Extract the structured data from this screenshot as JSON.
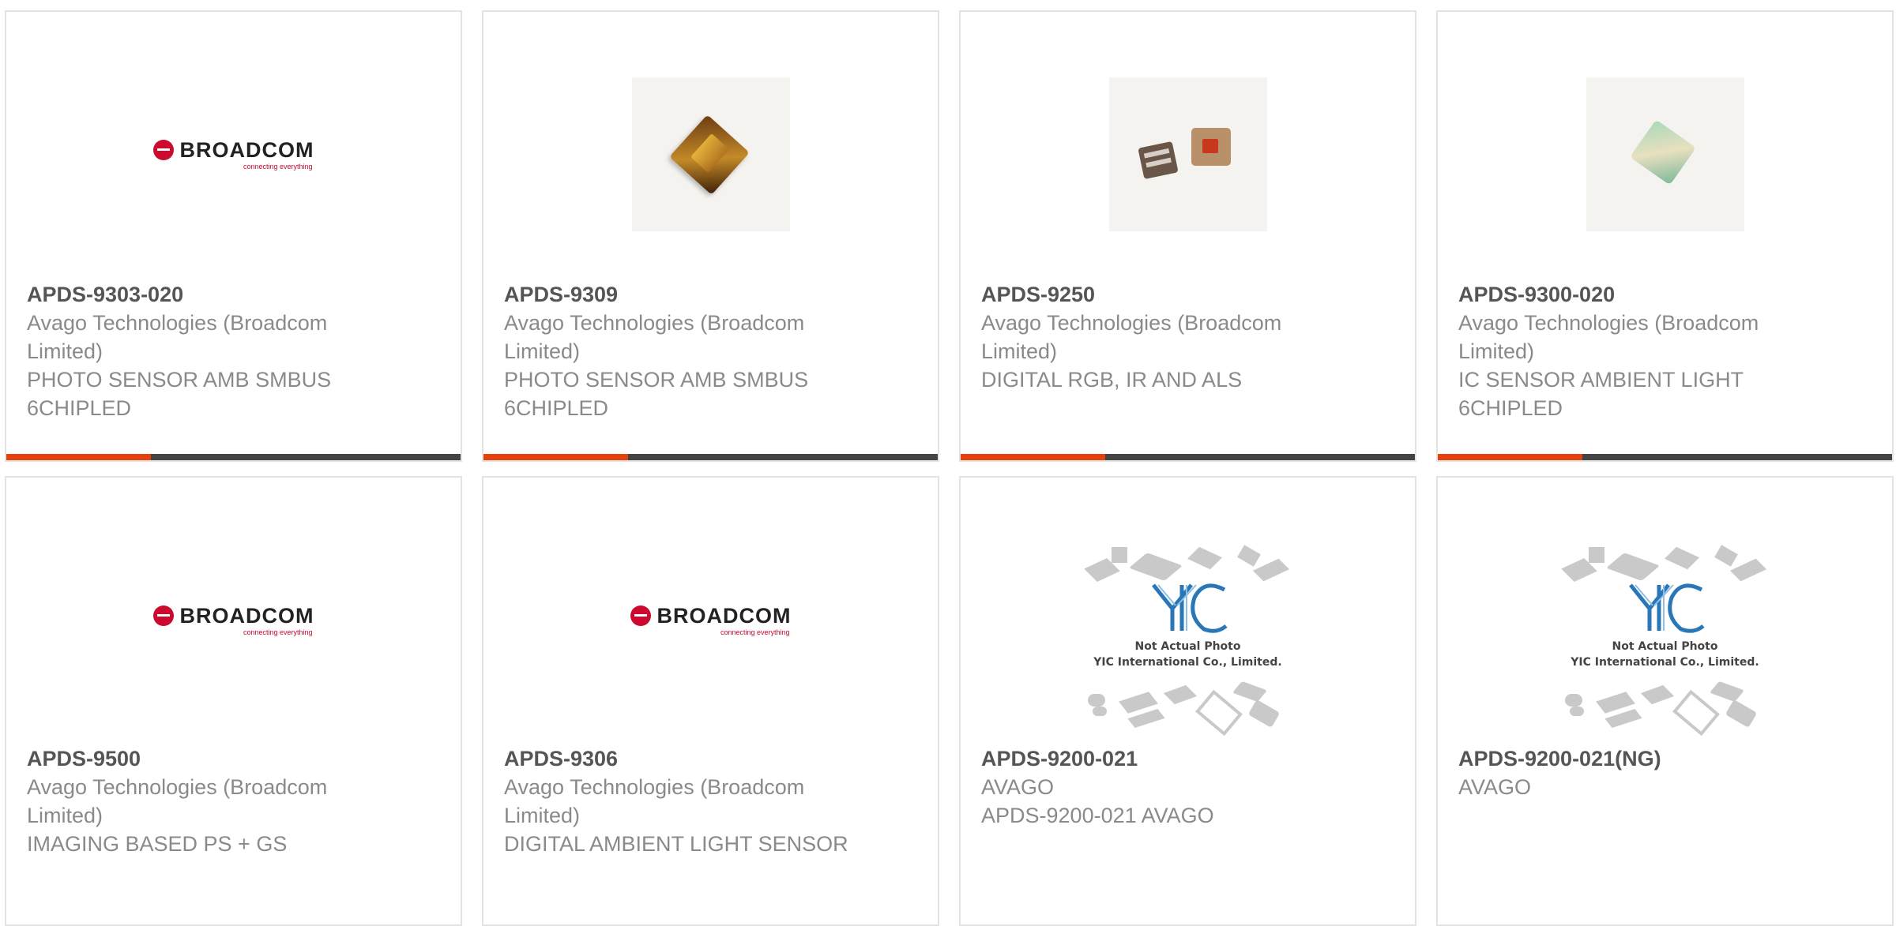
{
  "products": [
    {
      "part_number": "APDS-9303-020",
      "manufacturer": "Avago Technologies (Broadcom Limited)",
      "description": "PHOTO SENSOR AMB SMBUS 6CHIPLED",
      "image": "broadcom-logo"
    },
    {
      "part_number": "APDS-9309",
      "manufacturer": "Avago Technologies (Broadcom Limited)",
      "description": "PHOTO SENSOR AMB SMBUS 6CHIPLED",
      "image": "chip-photo"
    },
    {
      "part_number": "APDS-9250",
      "manufacturer": "Avago Technologies (Broadcom Limited)",
      "description": "DIGITAL RGB, IR AND ALS",
      "image": "chip-photo"
    },
    {
      "part_number": "APDS-9300-020",
      "manufacturer": "Avago Technologies (Broadcom Limited)",
      "description": "IC SENSOR AMBIENT LIGHT 6CHIPLED",
      "image": "chip-photo"
    },
    {
      "part_number": "APDS-9500",
      "manufacturer": "Avago Technologies (Broadcom Limited)",
      "description": "IMAGING BASED PS + GS",
      "image": "broadcom-logo"
    },
    {
      "part_number": "APDS-9306",
      "manufacturer": "Avago Technologies (Broadcom Limited)",
      "description": "DIGITAL AMBIENT LIGHT SENSOR",
      "image": "broadcom-logo"
    },
    {
      "part_number": "APDS-9200-021",
      "manufacturer": "AVAGO",
      "description": "APDS-9200-021 AVAGO",
      "image": "yic-placeholder"
    },
    {
      "part_number": "APDS-9200-021(NG)",
      "manufacturer": "AVAGO",
      "description": "",
      "image": "yic-placeholder"
    }
  ],
  "broadcom_logo": {
    "name": "BROADCOM",
    "tagline": "connecting everything"
  },
  "placeholder": {
    "line1": "Not Actual Photo",
    "line2": "YIC International Co., Limited."
  },
  "colors": {
    "accent": "#e4410c",
    "bar": "#444444",
    "part_number": "#555555",
    "text": "#8a8a8a"
  }
}
